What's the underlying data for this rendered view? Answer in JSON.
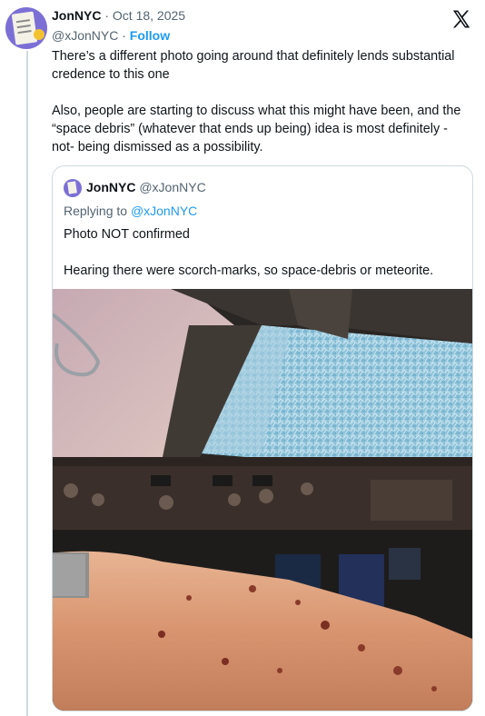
{
  "tweet": {
    "author_name": "JonNYC",
    "separator": " · ",
    "date": "Oct 18, 2025",
    "handle": "@xJonNYC",
    "follow_label": "Follow",
    "paragraph_1": "There’s a different photo going around that definitely lends substantial credence to this one",
    "paragraph_2": "Also, people are starting to discuss what this might have been, and the “space debris” (whatever that ends up being) idea is most definitely -not- being dismissed as a possibility."
  },
  "quoted_tweet": {
    "author_name": "JonNYC",
    "handle": "@xJonNYC",
    "replying_prefix": "Replying to ",
    "replying_to": "@xJonNYC",
    "paragraph_1": "Photo NOT confirmed",
    "paragraph_2": "Hearing there were scorch-marks, so space-debris or meteorite.",
    "image": {
      "kind": "photo",
      "subject": "cockpit with cracked windshield and injured arm"
    }
  },
  "icons": {
    "platform_logo": "x-logo-icon"
  },
  "colors": {
    "link_blue": "#1d9bf0",
    "secondary_text": "#536471",
    "border": "#cfd9de",
    "primary_text": "#0f1419"
  }
}
